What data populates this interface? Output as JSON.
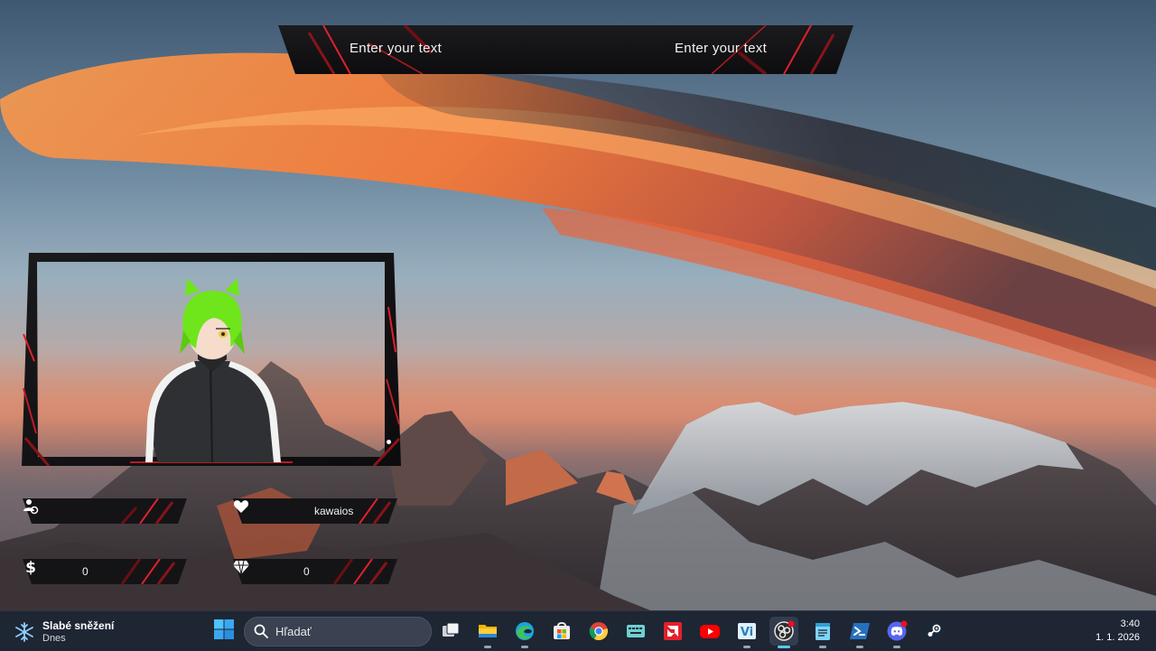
{
  "banner": {
    "left_text": "Enter your text",
    "right_text": "Enter your text"
  },
  "stats": {
    "followers_value": "",
    "likes_value": "kawaios",
    "money_value": "0",
    "gems_value": "0"
  },
  "taskbar": {
    "weather_title": "Slabé sněžení",
    "weather_subtitle": "Dnes",
    "search_placeholder": "Hľadať",
    "apps": [
      {
        "name": "Task View",
        "icon": "task-view-icon"
      },
      {
        "name": "File Explorer",
        "icon": "folder-icon"
      },
      {
        "name": "Microsoft Edge",
        "icon": "edge-icon"
      },
      {
        "name": "Microsoft Store",
        "icon": "store-icon"
      },
      {
        "name": "Google Chrome",
        "icon": "chrome-icon"
      },
      {
        "name": "Keyboard app",
        "icon": "keyboard-icon"
      },
      {
        "name": "AMD Software",
        "icon": "amd-icon"
      },
      {
        "name": "YouTube",
        "icon": "youtube-icon"
      },
      {
        "name": "VSeeFace",
        "icon": "vseeface-icon"
      },
      {
        "name": "OBS Studio",
        "icon": "obs-icon"
      },
      {
        "name": "Notepad",
        "icon": "notepad-icon"
      },
      {
        "name": "PowerShell",
        "icon": "powershell-icon"
      },
      {
        "name": "Discord",
        "icon": "discord-icon"
      },
      {
        "name": "Steam",
        "icon": "steam-icon"
      }
    ],
    "time": "3:40",
    "date": "1. 1. 2026"
  },
  "colors": {
    "accent_red": "#e0202a",
    "frame_dark": "#141416",
    "taskbar_bg": "#1e2634",
    "avatar_hair": "#6fe51c"
  }
}
